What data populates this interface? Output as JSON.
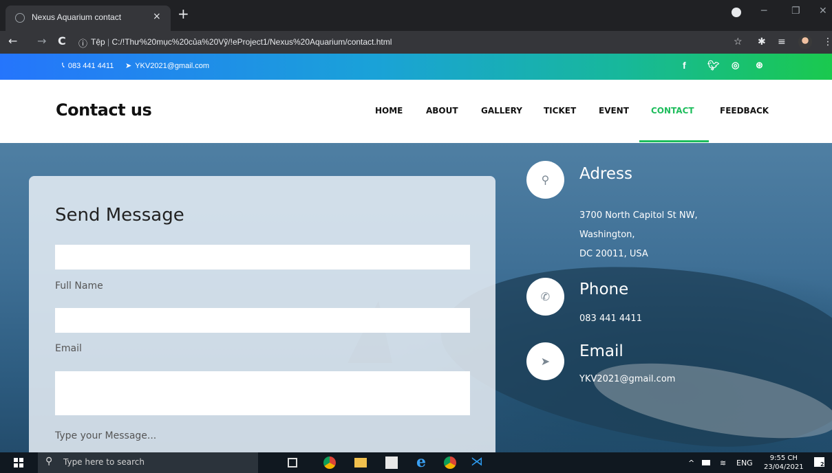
{
  "browser": {
    "tab_title": "Nexus Aquarium contact",
    "tab_close": "×",
    "new_tab": "+",
    "address_prefix": "Tệp",
    "address_sep": "|",
    "address_url": "C:/!Thư%20mục%20của%20Vỹ/!eProject1/Nexus%20Aquarium/contact.html"
  },
  "topbar": {
    "phone": "083 441 4411",
    "email": "YKV2021@gmail.com",
    "social": [
      "f",
      "t",
      "ig",
      "db"
    ]
  },
  "header": {
    "brand": "Contact us",
    "nav": [
      "HOME",
      "ABOUT",
      "GALLERY",
      "TICKET",
      "EVENT",
      "CONTACT",
      "FEEDBACK"
    ],
    "active": "CONTACT"
  },
  "form": {
    "title": "Send Message",
    "fields": [
      {
        "label": "Full Name",
        "value": ""
      },
      {
        "label": "Email",
        "value": ""
      },
      {
        "label": "Type your Message...",
        "value": ""
      }
    ]
  },
  "info": {
    "address": {
      "title": "Adress",
      "lines": [
        "3700 North Capitol St NW,",
        "Washington,",
        "DC 20011, USA"
      ]
    },
    "phone": {
      "title": "Phone",
      "value": "083 441 4411"
    },
    "email": {
      "title": "Email",
      "value": "YKV2021@gmail.com"
    }
  },
  "taskbar": {
    "search_placeholder": "Type here to search",
    "lang": "ENG",
    "time": "9:55 CH",
    "date": "23/04/2021",
    "notif_count": "2"
  },
  "colors": {
    "accent": "#1ebd5c",
    "topbar_start": "#2575fc",
    "topbar_end": "#1ac94e"
  }
}
